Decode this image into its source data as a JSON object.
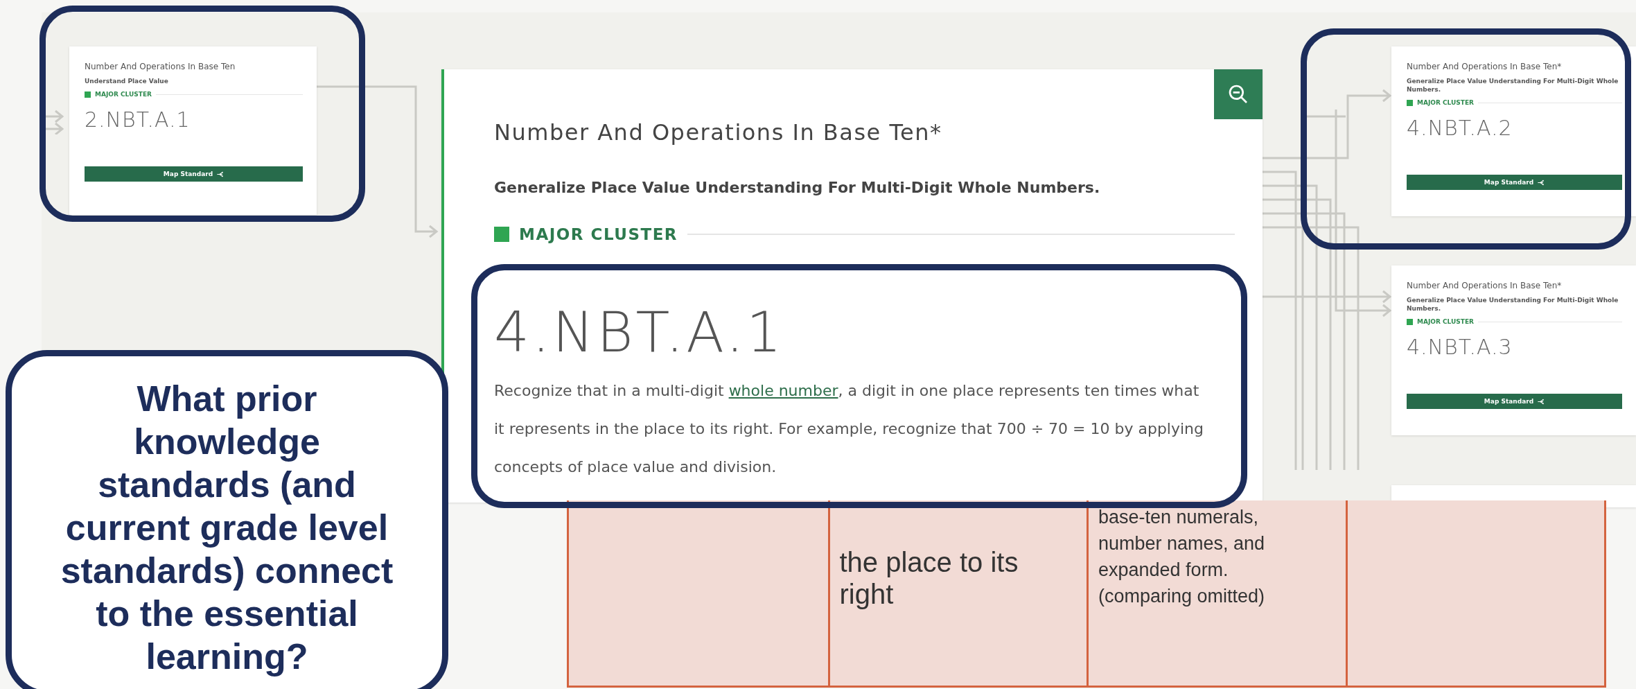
{
  "map": {
    "prior_card": {
      "title": "Number And Operations In Base Ten",
      "subtitle": "Understand Place Value",
      "cluster": "MAJOR CLUSTER",
      "code": "2.NBT.A.1",
      "button": "Map Standard"
    },
    "focus_card": {
      "title": "Number And Operations In Base Ten*",
      "subtitle": "Generalize Place Value Understanding For Multi-Digit Whole Numbers.",
      "cluster": "MAJOR CLUSTER",
      "code": "4.NBT.A.1",
      "description": [
        {
          "text": "Recognize that in a multi-digit ",
          "link": false
        },
        {
          "text": "whole number",
          "link": true
        },
        {
          "text": ", a digit in one place represents ten times what it represents in the place to its right. For example, recognize that 700 ÷ 70 = 10 by applying concepts of place value and division.",
          "link": false
        }
      ]
    },
    "next_cards": [
      {
        "title": "Number And Operations In Base Ten*",
        "subtitle": "Generalize Place Value Understanding For Multi-Digit Whole Numbers.",
        "cluster": "MAJOR CLUSTER",
        "code": "4.NBT.A.2",
        "button": "Map Standard"
      },
      {
        "title": "Number And Operations In Base Ten*",
        "subtitle": "Generalize Place Value Understanding For Multi-Digit Whole Numbers.",
        "cluster": "MAJOR CLUSTER",
        "code": "4.NBT.A.3",
        "button": "Map Standard"
      }
    ]
  },
  "table": {
    "cells": [
      "",
      "the place to its right",
      "base-ten numerals, number names, and expanded form. (comparing omitted)",
      ""
    ]
  },
  "question": "What prior knowledge standards (and current grade level standards) connect to the essential learning?"
}
